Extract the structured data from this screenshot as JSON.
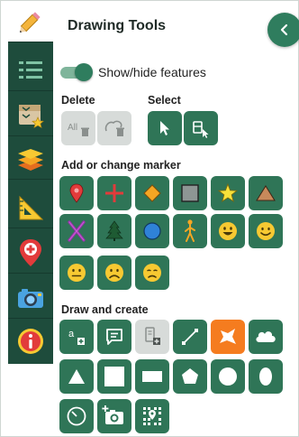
{
  "panel": {
    "title": "Drawing Tools",
    "toggle_label": "Show/hide features",
    "toggle_on": true
  },
  "sections": {
    "delete": "Delete",
    "select": "Select",
    "add_marker": "Add or change marker",
    "draw_create": "Draw and create"
  },
  "delete_buttons": [
    {
      "name": "delete-all",
      "text": "All",
      "state": "disabled"
    },
    {
      "name": "delete-selected",
      "state": "disabled"
    }
  ],
  "select_buttons": [
    {
      "name": "select-pointer"
    },
    {
      "name": "select-area"
    }
  ],
  "markers": [
    "pin",
    "cross",
    "diamond",
    "square",
    "star",
    "triangle",
    "x-mark",
    "tree",
    "circle",
    "person",
    "smile-big",
    "smile",
    "neutral-face",
    "sad-face",
    "frown-face"
  ],
  "draw_tools": [
    {
      "name": "text-tool",
      "text": "a"
    },
    {
      "name": "comment-tool"
    },
    {
      "name": "note-tool",
      "state": "disabled"
    },
    {
      "name": "line-tool"
    },
    {
      "name": "freehand-polygon-tool",
      "state": "selected"
    },
    {
      "name": "cloud-tool"
    },
    {
      "name": "triangle-tool"
    },
    {
      "name": "square-tool"
    },
    {
      "name": "rectangle-tool"
    },
    {
      "name": "pentagon-tool"
    },
    {
      "name": "circle-tool"
    },
    {
      "name": "ellipse-tool"
    },
    {
      "name": "measure-circle-tool"
    },
    {
      "name": "add-photo-tool"
    },
    {
      "name": "map-grid-tool"
    }
  ],
  "rail_items": [
    "pencil-icon",
    "legend-icon",
    "basemap-icon",
    "layers-icon",
    "measure-icon",
    "location-icon",
    "camera-icon",
    "info-icon"
  ],
  "colors": {
    "rail": "#1e4c3c",
    "button": "#2f7557",
    "accent": "#f57c1f",
    "disabled": "#d7dbd9",
    "marker_yellow": "#f7c932",
    "marker_red": "#e23b3b"
  }
}
